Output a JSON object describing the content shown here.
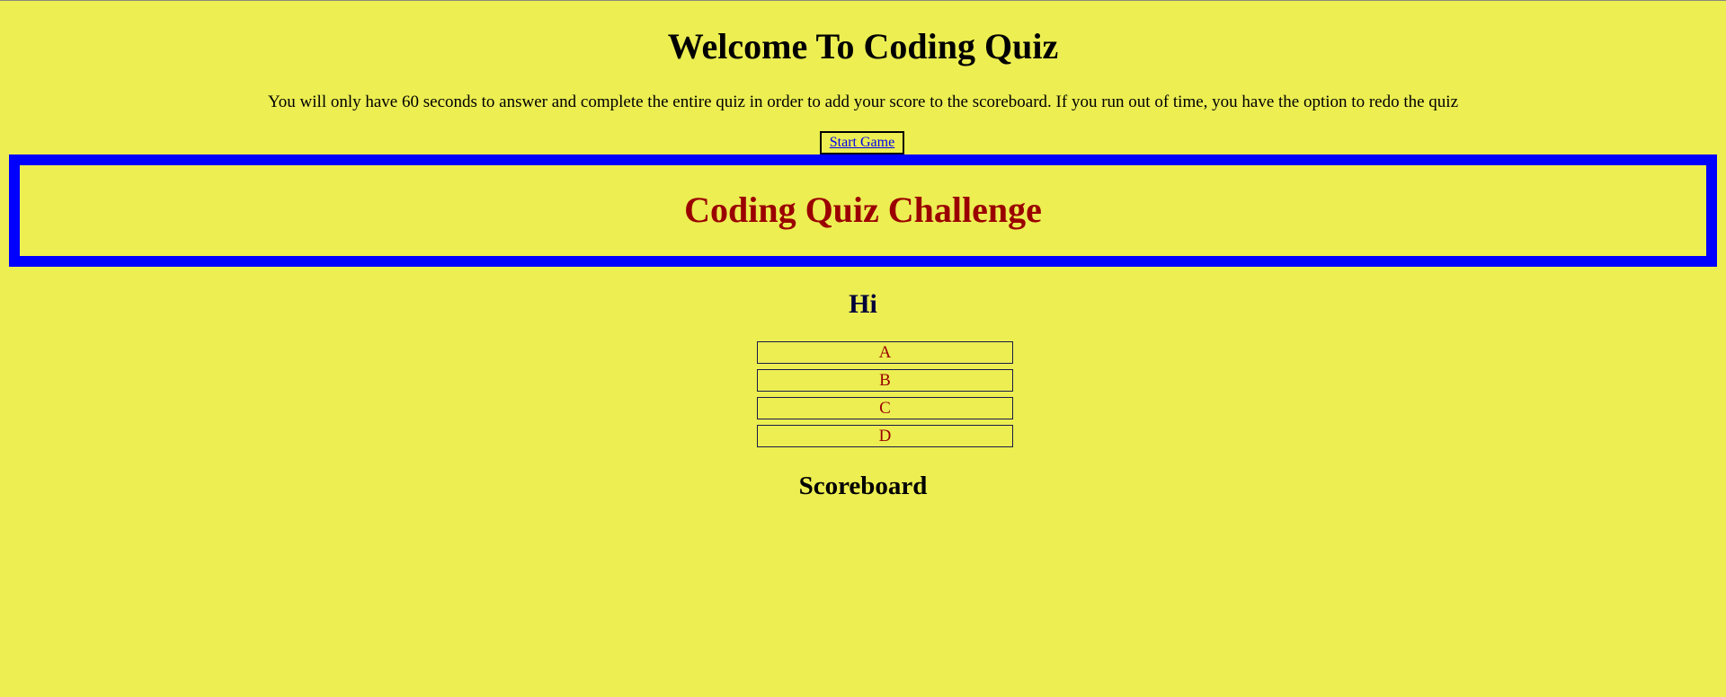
{
  "header": {
    "title": "Welcome To Coding Quiz",
    "instructions": "You will only have 60 seconds to answer and complete the entire quiz in order to add your score to the scoreboard. If you run out of time, you have the option to redo the quiz",
    "start_label": "Start Game"
  },
  "challenge": {
    "title": "Coding Quiz Challenge"
  },
  "question": {
    "title": "Hi",
    "answers": [
      "A",
      "B",
      "C",
      "D"
    ]
  },
  "scoreboard": {
    "title": "Scoreboard"
  },
  "colors": {
    "background": "#ecee52",
    "banner_border": "#0000ff",
    "challenge_text": "#9b0000",
    "link": "#0000ee"
  }
}
